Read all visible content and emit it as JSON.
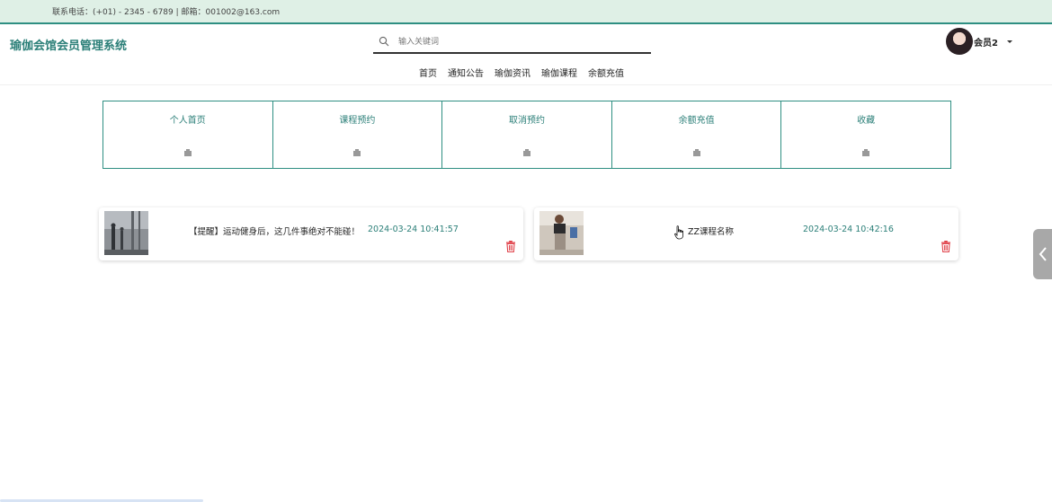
{
  "topbar": {
    "contact": "联系电话：(+01) - 2345 - 6789 | 邮箱：001002@163.com"
  },
  "header": {
    "site_title": "瑜伽会馆会员管理系统",
    "search": {
      "placeholder": "输入关键词",
      "value": ""
    },
    "user": {
      "name": "会员2"
    },
    "nav": [
      "首页",
      "通知公告",
      "瑜伽资讯",
      "瑜伽课程",
      "余额充值"
    ]
  },
  "center_menu": [
    {
      "label": "个人首页",
      "icon": "image-placeholder-icon"
    },
    {
      "label": "课程预约",
      "icon": "image-placeholder-icon"
    },
    {
      "label": "取消预约",
      "icon": "image-placeholder-icon"
    },
    {
      "label": "余额充值",
      "icon": "image-placeholder-icon"
    },
    {
      "label": "收藏",
      "icon": "image-placeholder-icon"
    }
  ],
  "favorites": [
    {
      "title": "【提醒】运动健身后，这几件事绝对不能碰！",
      "time": "2024-03-24 10:41:57",
      "icon": "trash-icon"
    },
    {
      "title": "ZZ课程名称",
      "time": "2024-03-24 10:42:16",
      "icon": "trash-icon"
    }
  ],
  "colors": {
    "accent": "#2b7f78",
    "topbar_bg": "#dff0e6",
    "delete": "#e0424a"
  }
}
